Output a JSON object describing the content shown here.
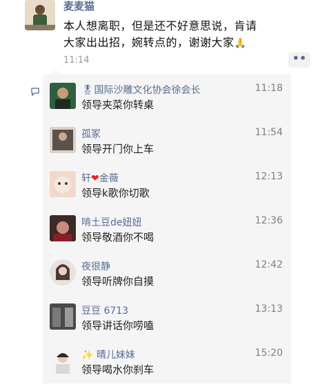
{
  "post": {
    "author": "麦麦猫",
    "text_line1": "本人想离职，但是还不好意思说，肯请",
    "text_line2": "大家出出招，婉转点的，谢谢大家",
    "emoji": "🙏",
    "time": "11:14",
    "more": "••"
  },
  "comments": [
    {
      "badge": "🎖",
      "name": "国际沙雕文化协会徐会长",
      "time": "11:18",
      "text": "领导夹菜你转桌"
    },
    {
      "badge": "",
      "name": "孤冢",
      "time": "11:54",
      "text": "领导开门你上车"
    },
    {
      "name_part1": "轩",
      "heart": "❤",
      "name_part2": "金薇",
      "time": "12:13",
      "text": "领导k歌你切歌"
    },
    {
      "badge": "",
      "name": "啃土豆de妞妞",
      "time": "12:36",
      "text": "领导敬酒你不喝"
    },
    {
      "badge": "",
      "name": "夜很静",
      "time": "12:42",
      "text": "领导听牌你自摸"
    },
    {
      "badge": "",
      "name": "豆豆 6713",
      "time": "13:13",
      "text": "领导讲话你唠嗑"
    },
    {
      "sparkle": "✨",
      "name": "晴儿妹妹",
      "time": "15:20",
      "text": "领导喝水你刹车"
    }
  ]
}
